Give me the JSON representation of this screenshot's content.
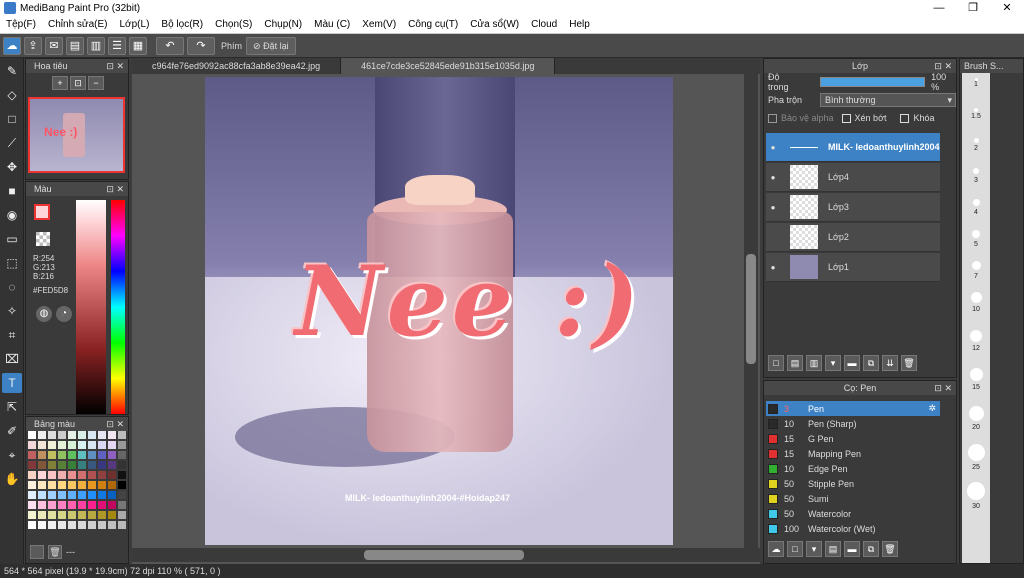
{
  "window": {
    "title": "MediBang Paint Pro (32bit)",
    "minimize": "—",
    "maximize": "❐",
    "close": "✕"
  },
  "menu": [
    "Tệp(F)",
    "Chỉnh sửa(E)",
    "Lớp(L)",
    "Bộ lọc(R)",
    "Chọn(S)",
    "Chụp(N)",
    "Màu (C)",
    "Xem(V)",
    "Công cụ(T)",
    "Cửa sổ(W)",
    "Cloud",
    "Help"
  ],
  "toolbar": {
    "shortcut_label": "Phím",
    "reset_label": "Đặt lại"
  },
  "navigator": {
    "title": "Hoa tiêu"
  },
  "color": {
    "title": "Màu",
    "r": "R:254",
    "g": "G:213",
    "b": "B:216",
    "hex": "#FED5D8",
    "primary": "#FED5D8"
  },
  "palette": {
    "title": "Bảng màu",
    "footer": "---"
  },
  "tabs": [
    "c964fe76ed9092ac88cfa3ab8e39ea42.jpg",
    "461ce7cde3ce52845ede91b315e1035d.jpg"
  ],
  "canvas": {
    "text": "Nee :)",
    "watermark": "MILK- ledoanthuylinh2004-#Hoidap247"
  },
  "layers": {
    "title": "Lớp",
    "opacity_label": "Độ trong",
    "opacity_value": "100 %",
    "opacity": 1.0,
    "blend_label": "Pha trộn",
    "blend_value": "Bình thường",
    "protect_alpha": "Bảo vệ alpha",
    "clip": "Xén bớt",
    "lock": "Khóa",
    "items": [
      {
        "name": "MILK- ledoanthuylinh2004",
        "selected": true
      },
      {
        "name": "Lớp4"
      },
      {
        "name": "Lớp3"
      },
      {
        "name": "Lớp2"
      },
      {
        "name": "Lớp1"
      }
    ]
  },
  "brush": {
    "title": "Cọ: Pen",
    "items": [
      {
        "size": "3",
        "name": "Pen",
        "color": "#2a2a2a",
        "selected": true
      },
      {
        "size": "10",
        "name": "Pen (Sharp)",
        "color": "#2a2a2a"
      },
      {
        "size": "15",
        "name": "G Pen",
        "color": "#e03030"
      },
      {
        "size": "15",
        "name": "Mapping Pen",
        "color": "#e03030"
      },
      {
        "size": "10",
        "name": "Edge Pen",
        "color": "#30b030"
      },
      {
        "size": "50",
        "name": "Stipple Pen",
        "color": "#e0d020"
      },
      {
        "size": "50",
        "name": "Sumi",
        "color": "#e0d020"
      },
      {
        "size": "50",
        "name": "Watercolor",
        "color": "#40c8e8"
      },
      {
        "size": "100",
        "name": "Watercolor (Wet)",
        "color": "#40c8e8"
      }
    ]
  },
  "brush_size": {
    "title": "Brush S...",
    "sizes": [
      "1",
      "1.5",
      "2",
      "3",
      "4",
      "5",
      "7",
      "10",
      "12",
      "15",
      "20",
      "25",
      "30"
    ]
  },
  "status": "564 * 564 pixel   (19.9 * 19.9cm)   72 dpi   110 %   ( 571, 0 )"
}
